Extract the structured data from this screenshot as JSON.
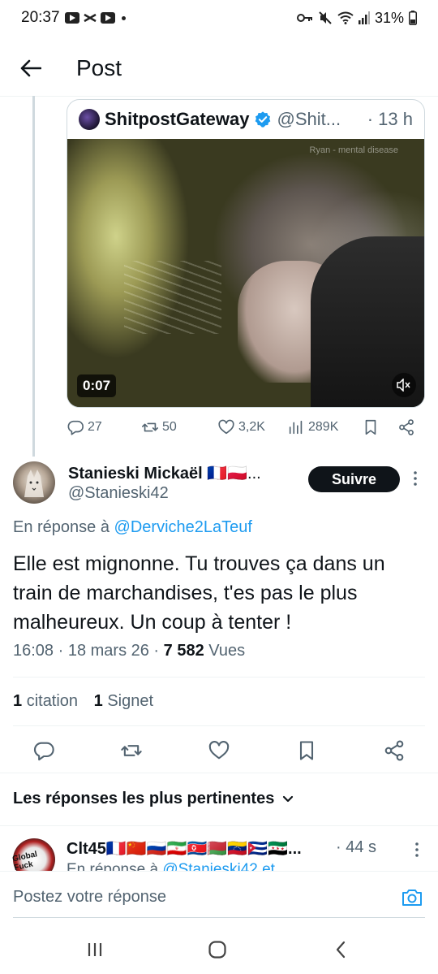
{
  "status_bar": {
    "time": "20:37",
    "battery": "31%",
    "icons": [
      "youtube-icon",
      "capcut-icon",
      "youtube-icon",
      "dot-icon",
      "vpn-key-icon",
      "mute-icon",
      "wifi-icon",
      "signal-icon",
      "battery-icon"
    ]
  },
  "header": {
    "title": "Post"
  },
  "quoted_post": {
    "author_name": "ShitpostGateway",
    "handle": "@Shit...",
    "time": "· 13 h",
    "video_duration": "0:07",
    "video_watermark": "Ryan - mental disease",
    "stats": {
      "replies": "27",
      "reposts": "50",
      "likes": "3,2K",
      "views": "289K"
    }
  },
  "post": {
    "author_name": "Stanieski Mickaël",
    "author_flags": "🇫🇷🇵🇱...",
    "handle": "@Stanieski42",
    "follow_label": "Suivre",
    "reply_prefix": "En réponse à",
    "reply_mention": "@Derviche2LaTeuf",
    "text": "Elle est mignonne. Tu trouves ça dans un train de marchandises, t'es pas le plus malheureux. Un coup à tenter !",
    "time": "16:08 · 18 mars 26 · ",
    "views_count": "7 582",
    "views_label": "Vues",
    "quote_count": "1",
    "quote_label": "citation",
    "bookmark_count": "1",
    "bookmark_label": "Signet"
  },
  "replies_section": {
    "sort_label": "Les réponses les plus pertinentes",
    "items": [
      {
        "author_name": "Clt45🇫🇷🇨🇳🇷🇺🇮🇷🇰🇵🇧🇾🇻🇪🇨🇺🇸🇾...",
        "time": "· 44 s",
        "reply_prefix": "En réponse à",
        "reply_mention": "@Stanieski42 et",
        "avatar_text": "Global Fuck"
      }
    ]
  },
  "compose": {
    "placeholder": "Postez votre réponse"
  },
  "colors": {
    "accent": "#1d9bf0",
    "text_primary": "#0f1419",
    "text_secondary": "#536471",
    "follow_bg": "#0f1419"
  }
}
